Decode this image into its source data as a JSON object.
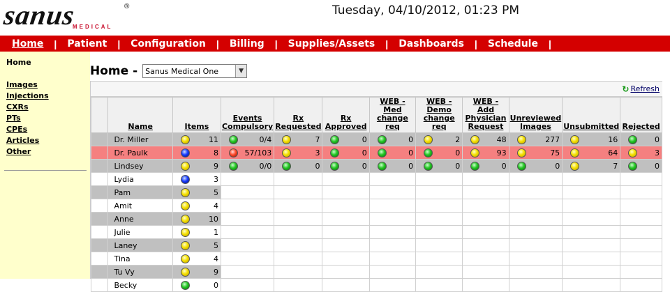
{
  "header": {
    "logo_main": "sanus",
    "logo_reg": "®",
    "logo_sub": "MEDICAL",
    "datetime": "Tuesday, 04/10/2012, 01:23 PM"
  },
  "nav": {
    "items": [
      {
        "label": "Home",
        "active": true
      },
      {
        "label": "Patient"
      },
      {
        "label": "Configuration"
      },
      {
        "label": "Billing"
      },
      {
        "label": "Supplies/Assets"
      },
      {
        "label": "Dashboards"
      },
      {
        "label": "Schedule"
      }
    ],
    "separator": "|"
  },
  "sidebar": {
    "home": "Home",
    "links": [
      "Images",
      "Injections",
      "CXRs",
      "PTs",
      "CPEs",
      "Articles",
      "Other"
    ]
  },
  "page": {
    "title": "Home -",
    "select_value": "Sanus Medical One",
    "refresh_label": "Refresh",
    "refresh_icon": "refresh-icon"
  },
  "table": {
    "columns": [
      "Name",
      "Items",
      "Events Compulsory",
      "Rx Requested",
      "Rx Approved",
      "WEB - Med change req",
      "WEB - Demo change req",
      "WEB - Add Physician Request",
      "Unreviewed Images",
      "Unsubmitted",
      "Rejected"
    ],
    "rows": [
      {
        "name": "Dr. Miller",
        "style": "gray",
        "cells": [
          {
            "dot": "yellow",
            "value": "11"
          },
          {
            "dot": "green",
            "value": "0/4"
          },
          {
            "dot": "yellow",
            "value": "7"
          },
          {
            "dot": "green",
            "value": "0"
          },
          {
            "dot": "green",
            "value": "0"
          },
          {
            "dot": "yellow",
            "value": "2"
          },
          {
            "dot": "yellow",
            "value": "48"
          },
          {
            "dot": "yellow",
            "value": "277"
          },
          {
            "dot": "yellow",
            "value": "16"
          },
          {
            "dot": "green",
            "value": "0"
          }
        ]
      },
      {
        "name": "Dr. Paulk",
        "style": "red",
        "cells": [
          {
            "dot": "blue",
            "value": "8"
          },
          {
            "dot": "red",
            "value": "57/103"
          },
          {
            "dot": "yellow",
            "value": "3"
          },
          {
            "dot": "green",
            "value": "0"
          },
          {
            "dot": "green",
            "value": "0"
          },
          {
            "dot": "green",
            "value": "0"
          },
          {
            "dot": "yellow",
            "value": "93"
          },
          {
            "dot": "yellow",
            "value": "75"
          },
          {
            "dot": "yellow",
            "value": "64"
          },
          {
            "dot": "yellow",
            "value": "3"
          }
        ]
      },
      {
        "name": "Lindsey",
        "style": "gray",
        "cells": [
          {
            "dot": "yellow",
            "value": "9"
          },
          {
            "dot": "green",
            "value": "0/0"
          },
          {
            "dot": "green",
            "value": "0"
          },
          {
            "dot": "green",
            "value": "0"
          },
          {
            "dot": "green",
            "value": "0"
          },
          {
            "dot": "green",
            "value": "0"
          },
          {
            "dot": "green",
            "value": "0"
          },
          {
            "dot": "green",
            "value": "0"
          },
          {
            "dot": "yellow",
            "value": "7"
          },
          {
            "dot": "green",
            "value": "0"
          }
        ]
      },
      {
        "name": "Lydia",
        "style": "white",
        "cells": [
          {
            "dot": "blue",
            "value": "3"
          }
        ]
      },
      {
        "name": "Pam",
        "style": "gray",
        "cells": [
          {
            "dot": "yellow",
            "value": "5"
          }
        ]
      },
      {
        "name": "Amit",
        "style": "white",
        "cells": [
          {
            "dot": "yellow",
            "value": "4"
          }
        ]
      },
      {
        "name": "Anne",
        "style": "gray",
        "cells": [
          {
            "dot": "yellow",
            "value": "10"
          }
        ]
      },
      {
        "name": "Julie",
        "style": "white",
        "cells": [
          {
            "dot": "yellow",
            "value": "1"
          }
        ]
      },
      {
        "name": "Laney",
        "style": "gray",
        "cells": [
          {
            "dot": "yellow",
            "value": "5"
          }
        ]
      },
      {
        "name": "Tina",
        "style": "white",
        "cells": [
          {
            "dot": "yellow",
            "value": "4"
          }
        ]
      },
      {
        "name": "Tu Vy",
        "style": "gray",
        "cells": [
          {
            "dot": "yellow",
            "value": "9"
          }
        ]
      },
      {
        "name": "Becky",
        "style": "white",
        "cells": [
          {
            "dot": "green",
            "value": "0"
          }
        ]
      }
    ]
  }
}
